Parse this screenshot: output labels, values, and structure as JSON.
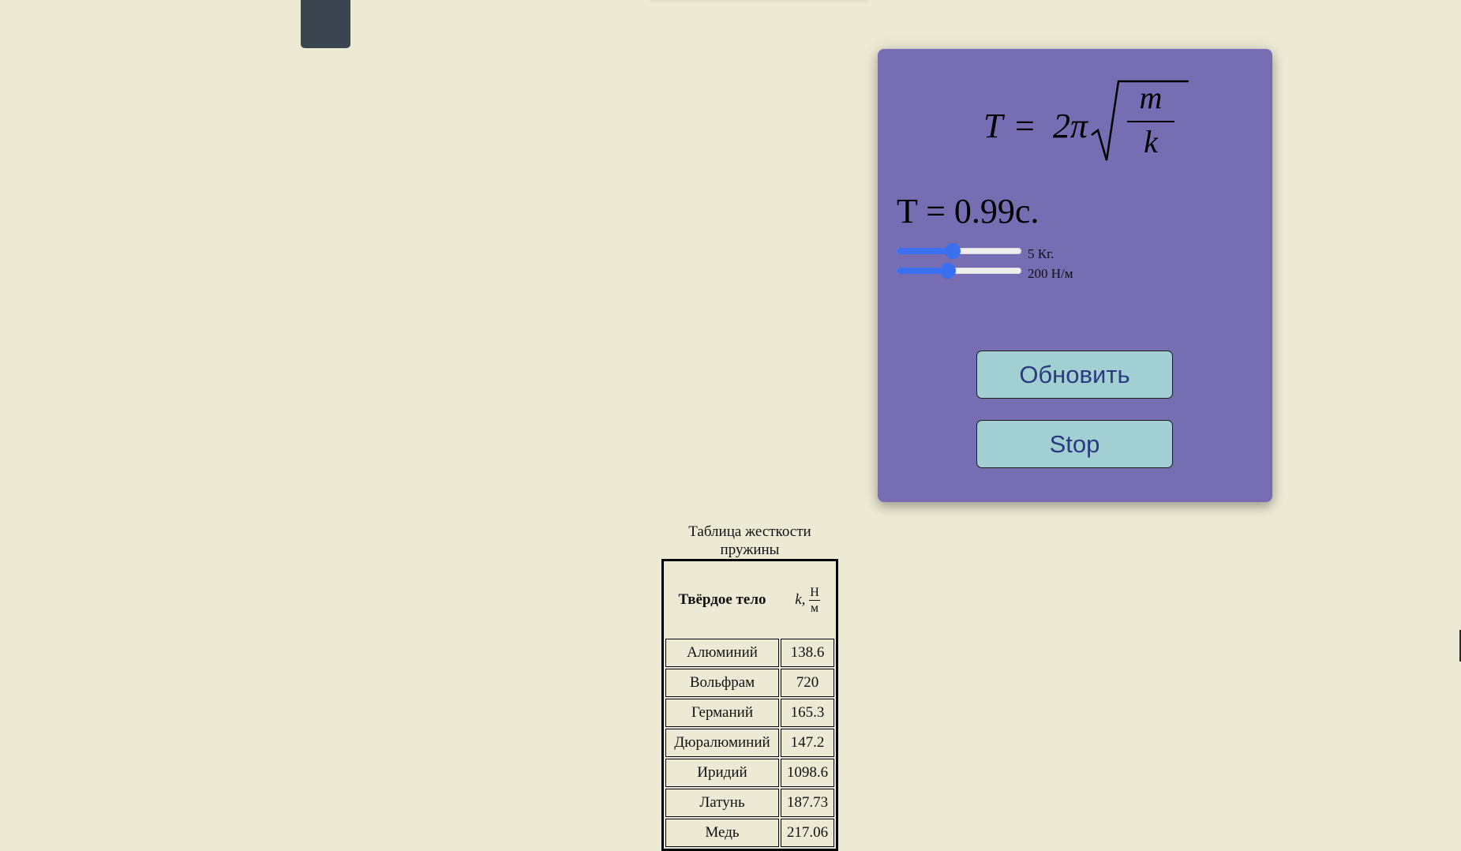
{
  "formula": {
    "lhs": "T",
    "equals": "=",
    "coefficient": "2π",
    "numerator": "m",
    "denominator": "k"
  },
  "result": {
    "text": "T = 0.99с."
  },
  "controls": {
    "mass_slider": {
      "label": "5 Кг.",
      "level_fraction": 0.45
    },
    "stiffness_slider": {
      "label": "200 Н/м",
      "level_fraction": 0.41
    },
    "update_button": "Обновить",
    "stop_button": "Stop"
  },
  "colors": {
    "page_background": "#ece9d4",
    "panel_background": "#776db3",
    "button_background": "#a2d0d2",
    "button_text": "#2b3a80",
    "slider_accent": "#3a70f0",
    "mass_block": "#3b4550"
  },
  "table": {
    "caption": "Таблица жесткости пружины",
    "header_material": "Твёрдое тело",
    "header_k_symbol": "k,",
    "header_unit_numerator": "Н",
    "header_unit_denominator": "м",
    "rows": [
      {
        "material": "Алюминий",
        "k": "138.6"
      },
      {
        "material": "Вольфрам",
        "k": "720"
      },
      {
        "material": "Германий",
        "k": "165.3"
      },
      {
        "material": "Дюралюминий",
        "k": "147.2"
      },
      {
        "material": "Иридий",
        "k": "1098.6"
      },
      {
        "material": "Латунь",
        "k": "187.73"
      },
      {
        "material": "Медь",
        "k": "217.06"
      }
    ]
  }
}
